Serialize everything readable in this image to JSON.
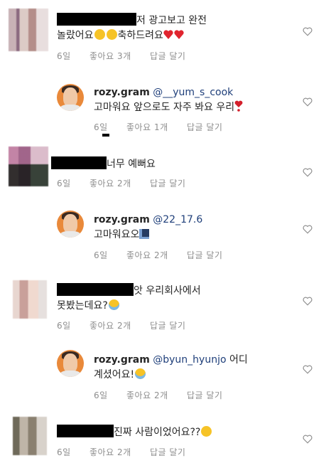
{
  "comments": [
    {
      "text": "저 광고보고 완전",
      "text2": "놀랐어요",
      "text3": "축하드려요",
      "time": "6일",
      "likes": "좋아요 3개",
      "reply": "답글 달기"
    },
    {
      "username": "rozy.gram",
      "mention": "@__yum_s_cook",
      "text": "고마워요 앞으로도 자주 봐요 우리",
      "time": "6일",
      "likes": "좋아요 1개",
      "reply": "답글 달기"
    },
    {
      "text": "너무 예뻐요",
      "time": "6일",
      "likes": "좋아요 2개",
      "reply": "답글 달기"
    },
    {
      "username": "rozy.gram",
      "mention": "@22_17.6",
      "text": "고마워요오",
      "time": "6일",
      "likes": "좋아요 2개",
      "reply": "답글 달기"
    },
    {
      "text": "앗 우리회사에서",
      "text2": "못봤는데요?",
      "time": "6일",
      "likes": "좋아요 2개",
      "reply": "답글 달기"
    },
    {
      "username": "rozy.gram",
      "mention": "@byun_hyunjo",
      "text": "어디",
      "text2": "계셨어요!",
      "time": "6일",
      "likes": "좋아요 2개",
      "reply": "답글 달기"
    },
    {
      "text": "진짜 사람이었어요??",
      "time": "6일",
      "likes": "좋아요 2개",
      "reply": "답글 달기"
    }
  ],
  "icons": {
    "like": "heart-outline-icon",
    "emoji_heart_eyes": "heart-eyes-emoji",
    "emoji_red_heart": "red-heart-emoji",
    "emoji_exclamation": "red-exclamation-heart-emoji",
    "emoji_laugh": "sweat-smile-emoji",
    "emoji_cry": "crying-emoji",
    "emoji_night": "night-sky-emoji"
  },
  "colors": {
    "text": "#262626",
    "meta": "#8e8e8e",
    "mention": "#1f3f7a",
    "avatar_orange": "#e9893a"
  }
}
